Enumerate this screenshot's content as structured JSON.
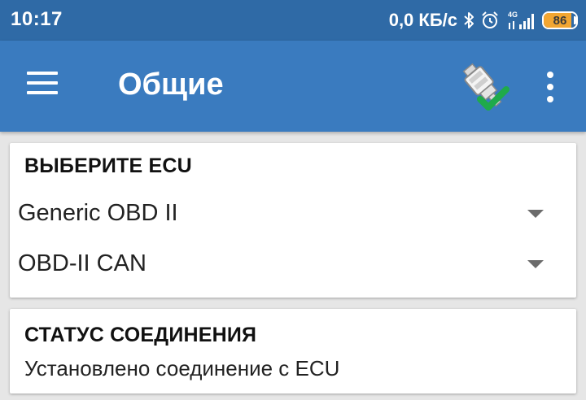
{
  "status_bar": {
    "time": "10:17",
    "network_speed": "0,0 КБ/с",
    "icons": [
      "bluetooth-icon",
      "alarm-icon",
      "signal-4g-icon"
    ],
    "network_type": "4G",
    "battery_level": "86",
    "battery_fraction": 0.86,
    "colors": {
      "background": "#2f6aa6",
      "battery_fill": "#f2a632"
    }
  },
  "toolbar": {
    "title": "Общие",
    "menu_icon": "hamburger-menu-icon",
    "connection_icon": "obd-connector-connected-icon",
    "overflow_icon": "more-vert-icon",
    "colors": {
      "background": "#3a7bbf",
      "check": "#1faa4a"
    }
  },
  "ecu_card": {
    "header": "ВЫБЕРИТЕ ECU",
    "ecu_spinner": {
      "value": "Generic OBD II"
    },
    "protocol_spinner": {
      "value": "OBD-II CAN"
    }
  },
  "status_card": {
    "header": "СТАТУС СОЕДИНЕНИЯ",
    "text": "Установлено соединение с ECU"
  }
}
